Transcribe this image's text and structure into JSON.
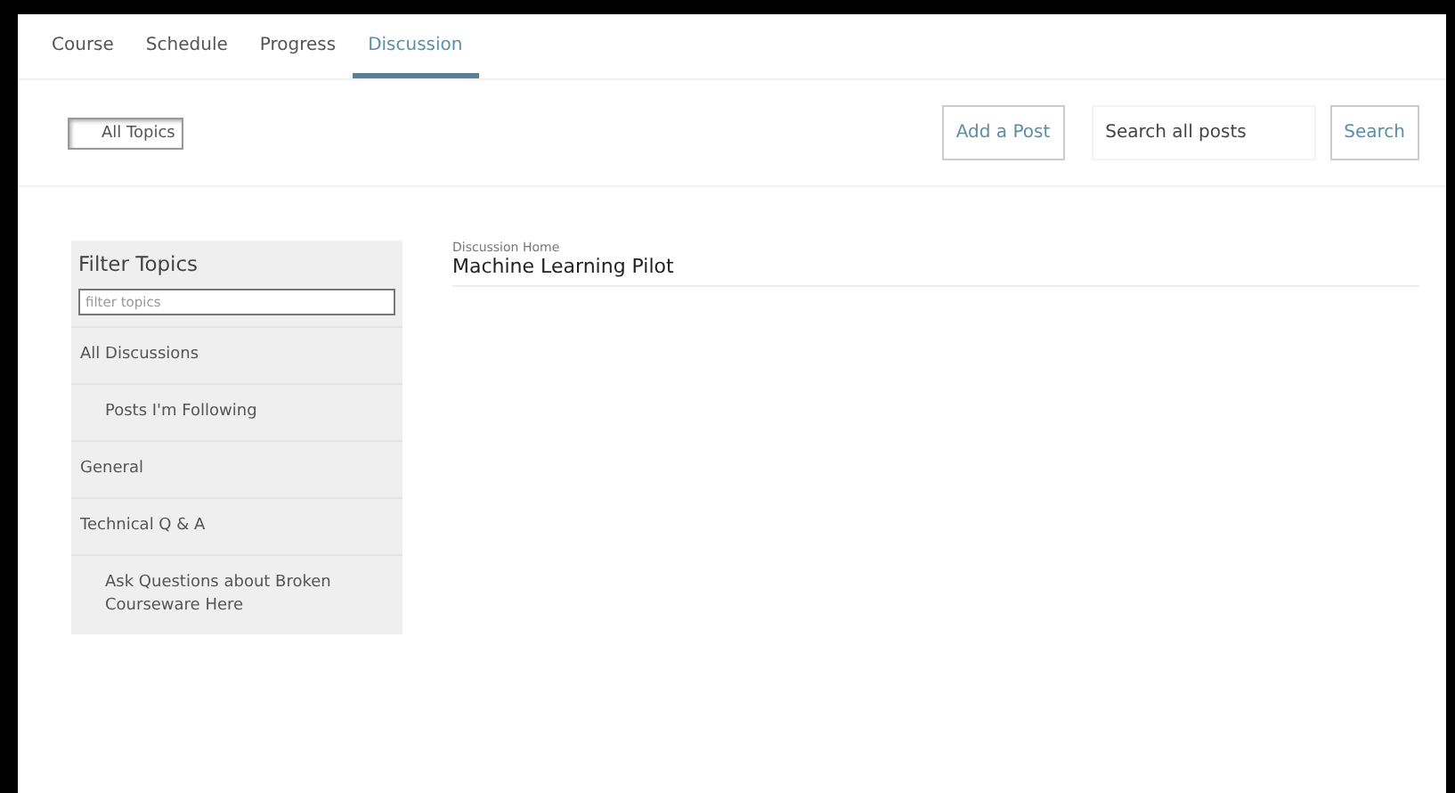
{
  "tabs": [
    {
      "label": "Course",
      "selected": false
    },
    {
      "label": "Schedule",
      "selected": false
    },
    {
      "label": "Progress",
      "selected": false
    },
    {
      "label": "Discussion",
      "selected": true
    }
  ],
  "topics_button": "All Topics",
  "add_post": "Add a Post",
  "search": {
    "placeholder": "Search all posts",
    "button": "Search"
  },
  "sidebar": {
    "title": "Filter Topics",
    "filter_placeholder": "filter topics",
    "items": [
      {
        "label": "All Discussions",
        "children": [
          {
            "label": "Posts I'm Following"
          }
        ]
      },
      {
        "label": "General"
      },
      {
        "label": "Technical Q & A",
        "children": [
          {
            "label": "Ask Questions about Broken Courseware Here"
          }
        ]
      }
    ]
  },
  "main": {
    "breadcrumb": "Discussion Home",
    "title": "Machine Learning Pilot"
  }
}
